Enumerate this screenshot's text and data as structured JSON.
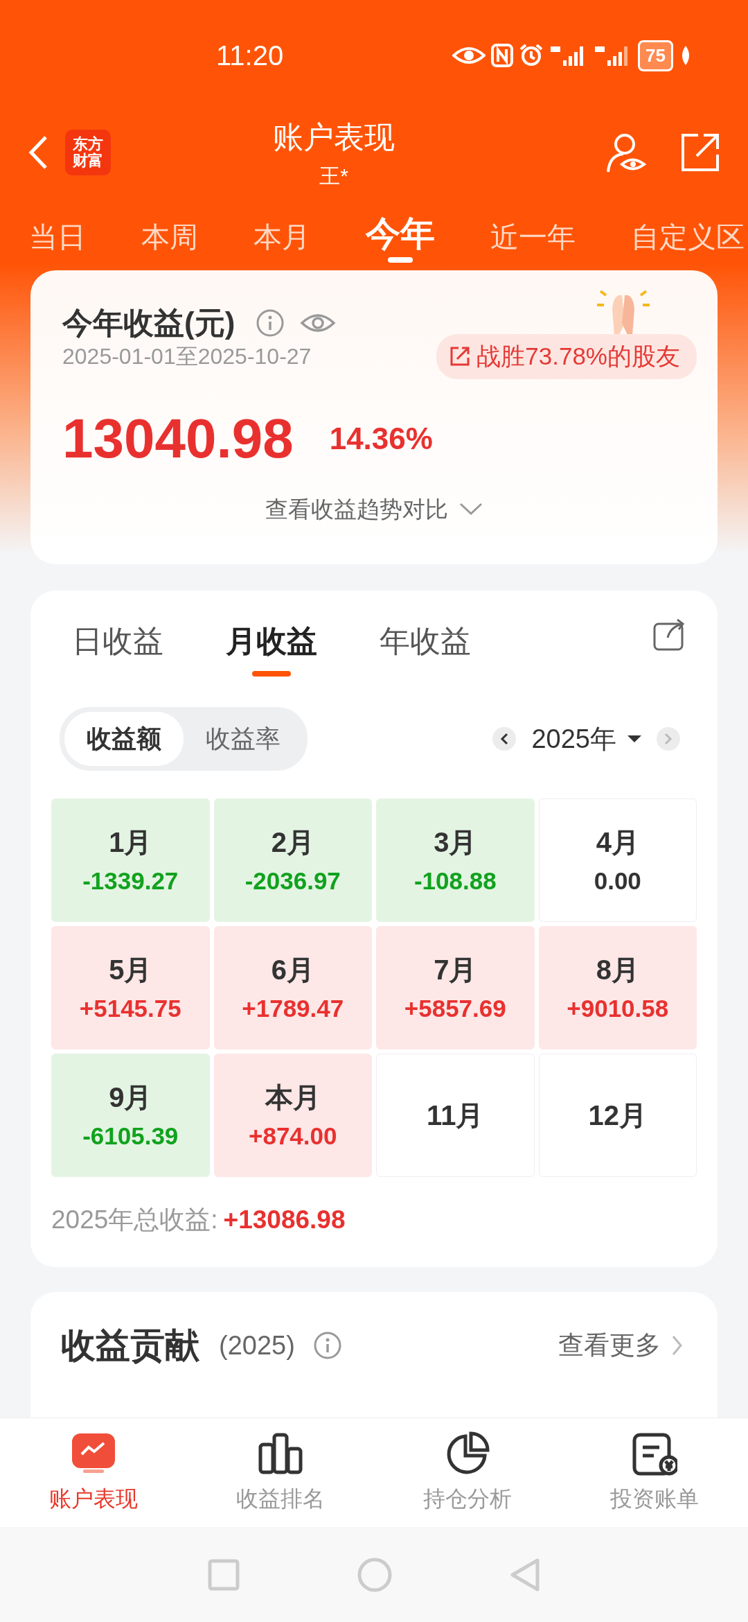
{
  "status_bar": {
    "time": "11:20",
    "battery": "75"
  },
  "header": {
    "title": "账户表现",
    "subtitle": "王*",
    "logo_lines": [
      "东方",
      "财富"
    ]
  },
  "period_tabs": [
    {
      "label": "当日",
      "selected": false
    },
    {
      "label": "本周",
      "selected": false
    },
    {
      "label": "本月",
      "selected": false
    },
    {
      "label": "今年",
      "selected": true
    },
    {
      "label": "近一年",
      "selected": false
    },
    {
      "label": "自定义区",
      "selected": false
    }
  ],
  "summary": {
    "title": "今年收益(元)",
    "date_range": "2025-01-01至2025-10-27",
    "beat_badge": "战胜73.78%的股友",
    "amount": "13040.98",
    "rate": "14.36%",
    "trend_link": "查看收益趋势对比"
  },
  "income": {
    "tabs": [
      {
        "label": "日收益",
        "selected": false
      },
      {
        "label": "月收益",
        "selected": true
      },
      {
        "label": "年收益",
        "selected": false
      }
    ],
    "toggle": [
      {
        "label": "收益额",
        "selected": true
      },
      {
        "label": "收益率",
        "selected": false
      }
    ],
    "year": "2025年",
    "months": [
      {
        "label": "1月",
        "value": "-1339.27",
        "kind": "loss"
      },
      {
        "label": "2月",
        "value": "-2036.97",
        "kind": "loss"
      },
      {
        "label": "3月",
        "value": "-108.88",
        "kind": "loss"
      },
      {
        "label": "4月",
        "value": "0.00",
        "kind": "flat"
      },
      {
        "label": "5月",
        "value": "+5145.75",
        "kind": "gain"
      },
      {
        "label": "6月",
        "value": "+1789.47",
        "kind": "gain"
      },
      {
        "label": "7月",
        "value": "+5857.69",
        "kind": "gain"
      },
      {
        "label": "8月",
        "value": "+9010.58",
        "kind": "gain"
      },
      {
        "label": "9月",
        "value": "-6105.39",
        "kind": "loss"
      },
      {
        "label": "本月",
        "value": "+874.00",
        "kind": "gain"
      },
      {
        "label": "11月",
        "kind": "future"
      },
      {
        "label": "12月",
        "kind": "future"
      }
    ],
    "total_label": "2025年总收益:",
    "total_value": "+13086.98"
  },
  "contribution": {
    "title": "收益贡献",
    "year": "(2025)",
    "more": "查看更多"
  },
  "bottom_nav": [
    {
      "label": "账户表现",
      "selected": true
    },
    {
      "label": "收益排名",
      "selected": false
    },
    {
      "label": "持仓分析",
      "selected": false
    },
    {
      "label": "投资账单",
      "selected": false
    }
  ]
}
